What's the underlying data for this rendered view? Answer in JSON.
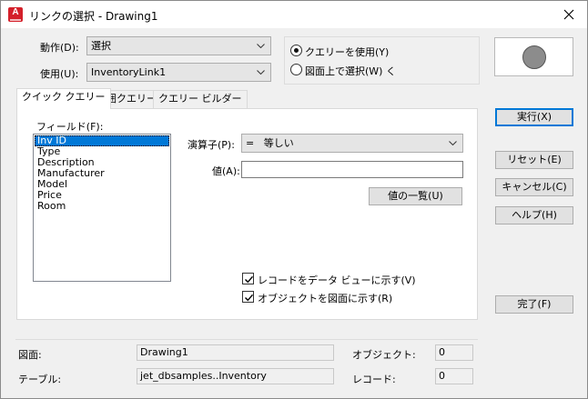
{
  "window": {
    "title": "リンクの選択 - Drawing1",
    "icon_letter": "A"
  },
  "action": {
    "label": "動作(D):",
    "value": "選択"
  },
  "use": {
    "label": "使用(U):",
    "value": "InventoryLink1"
  },
  "mode": {
    "use_query": "クエリーを使用(Y)",
    "select_in_drawing": "図面上で選択(W) く",
    "selected": "use_query"
  },
  "tabs": [
    {
      "label": "クイック クエリー",
      "active": true
    },
    {
      "label": "範囲クエリー",
      "active": false
    },
    {
      "label": "クエリー ビルダー",
      "active": false
    }
  ],
  "fields": {
    "label": "フィールド(F):",
    "items": [
      "Inv ID",
      "Type",
      "Description",
      "Manufacturer",
      "Model",
      "Price",
      "Room"
    ],
    "selected_index": 0
  },
  "operator": {
    "label": "演算子(P):",
    "value": "=   等しい"
  },
  "value_field": {
    "label": "値(A):",
    "value": ""
  },
  "value_list_button": "値の一覧(U)",
  "checks": {
    "show_record": "レコードをデータ ビューに示す(V)",
    "show_object": "オブジェクトを図面に示す(R)"
  },
  "buttons": {
    "execute": "実行(X)",
    "reset": "リセット(E)",
    "cancel": "キャンセル(C)",
    "help": "ヘルプ(H)",
    "done": "完了(F)"
  },
  "status": {
    "drawing_label": "図面:",
    "drawing_value": "Drawing1",
    "table_label": "テーブル:",
    "table_value": "jet_dbsamples..Inventory",
    "object_label": "オブジェクト:",
    "object_value": "0",
    "record_label": "レコード:",
    "record_value": "0"
  },
  "colors": {
    "accent": "#0078d7",
    "app_icon": "#d4202a",
    "preview_circle": "#8c8c8c"
  }
}
